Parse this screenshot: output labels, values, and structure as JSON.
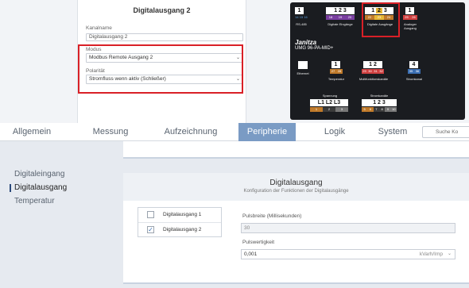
{
  "popup": {
    "title": "Digitalausgang 2",
    "kanalname_label": "Kanalname",
    "kanalname_value": "Digitalausgang 2",
    "modus_label": "Modus",
    "modus_value": "Modbus Remote Ausgang 2",
    "polaritaet_label": "Polarität",
    "polaritaet_value": "Stromfluss wenn aktiv (Schließer)"
  },
  "device": {
    "top_groups": [
      {
        "nums": "1",
        "pins": "14 15 16",
        "label": "RS-485"
      },
      {
        "nums": "1 2 3",
        "pins": "18 19 20",
        "label": "Digitale Eingänge"
      },
      {
        "nums": "1 2 3",
        "pins": "22 23 24",
        "label": "Digitale Ausgänge"
      },
      {
        "nums": "1",
        "pins": "25 26",
        "label": "Analoger Ausgang"
      }
    ],
    "brand": "Janitza",
    "model": "UMG 96-PA-MID+",
    "mid_groups": [
      {
        "nums": "1",
        "pins": "27 28",
        "label": "Temperatur"
      },
      {
        "nums": "1 2",
        "pins": "29 30 31 32",
        "label": "Multifunktionskanäle"
      },
      {
        "nums": "4",
        "pins": "35 36",
        "label": "Stromkanal"
      }
    ],
    "ethernet_label": "Ethernet",
    "spannung_label": "Spannung",
    "spannung_values": "L1 L2 L3",
    "spannung_pins": "1 2 3",
    "stromkanaele_label": "Stromkanäle",
    "stromkanaele_values": "1 2 3",
    "stromkanaele_pins": "5 6 7 8 9 10"
  },
  "nav": {
    "tabs": [
      "Allgemein",
      "Messung",
      "Aufzeichnung",
      "Peripherie",
      "Logik",
      "System"
    ],
    "active_tab": "Peripherie",
    "search_placeholder": "Suche Ko"
  },
  "sidebar": {
    "items": [
      "Digitaleingang",
      "Digitalausgang",
      "Temperatur"
    ],
    "active": "Digitalausgang"
  },
  "panel": {
    "title": "Digitalausgang",
    "subtitle": "Konfiguration der Funktionen der Digitalausgänge",
    "outputs": [
      {
        "label": "Digitalausgang 1",
        "checked": false
      },
      {
        "label": "Digitalausgang 2",
        "checked": true
      }
    ],
    "pulsbreite_label": "Pulsbreite (Millisekunden)",
    "pulsbreite_value": "30",
    "pulswertigkeit_label": "Pulswertigkeit",
    "pulswertigkeit_value": "0,001",
    "pulswertigkeit_unit": "kVarh/Imp"
  },
  "colors": {
    "accent": "#7a9bc4",
    "highlight": "#d92027",
    "device_bg": "#1a1c20",
    "pin_orange": "#c07a2a",
    "pin_yellow": "#e8b838"
  }
}
